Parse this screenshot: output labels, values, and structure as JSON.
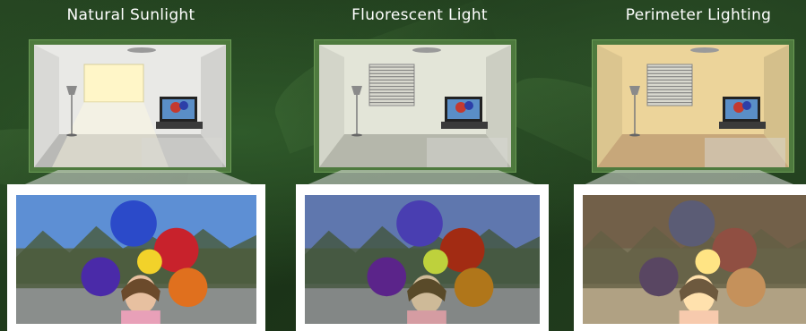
{
  "panels": [
    {
      "title": "Natural Sunlight",
      "tint": "none",
      "wall_color": "#e9e9e6",
      "floor_color": "#b9b9b6"
    },
    {
      "title": "Fluorescent Light",
      "tint": "blue",
      "wall_color": "#e3e5d8",
      "floor_color": "#b5b7ab"
    },
    {
      "title": "Perimeter Lighting",
      "tint": "warm",
      "wall_color": "#ecd49a",
      "floor_color": "#c7a77a"
    }
  ],
  "colors": {
    "frame_green": "#4e7a3e",
    "background_green": "#1f3a1d"
  },
  "icons": [
    "ceiling-light-icon",
    "floor-lamp-icon",
    "window-icon",
    "tv-icon",
    "tv-stand-icon",
    "balloon-icon"
  ]
}
